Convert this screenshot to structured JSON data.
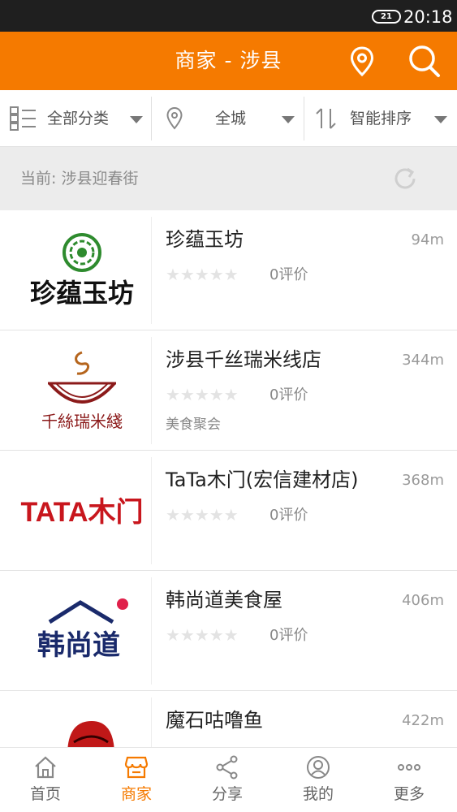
{
  "status_bar": {
    "battery": "21",
    "time": "20:18"
  },
  "header": {
    "title": "商家 - 涉县",
    "icons": [
      "location-pin-icon",
      "search-icon"
    ]
  },
  "filters": [
    {
      "label": "全部分类",
      "icon": "category-grid-icon"
    },
    {
      "label": "全城",
      "icon": "location-pin-icon"
    },
    {
      "label": "智能排序",
      "icon": "sort-arrows-icon"
    }
  ],
  "current_location": {
    "text": "当前: 涉县迎春街",
    "icon": "refresh-icon"
  },
  "merchants": [
    {
      "name": "珍蕴玉坊",
      "distance": "94m",
      "stars": 0,
      "reviews": "0评价",
      "category": "",
      "logo_text": "珍蕴玉坊"
    },
    {
      "name": "涉县千丝瑞米线店",
      "distance": "344m",
      "stars": 0,
      "reviews": "0评价",
      "category": "美食聚会",
      "logo_text": "千絲瑞米綫"
    },
    {
      "name": "TaTa木门(宏信建材店)",
      "distance": "368m",
      "stars": 0,
      "reviews": "0评价",
      "category": "",
      "logo_text": "TATA木门"
    },
    {
      "name": "韩尚道美食屋",
      "distance": "406m",
      "stars": 0,
      "reviews": "0评价",
      "category": "",
      "logo_text": "韩尚道"
    },
    {
      "name": "魔石咕噜鱼",
      "distance": "422m",
      "stars": 0,
      "reviews": "",
      "category": "",
      "logo_text": ""
    }
  ],
  "tabs": [
    {
      "label": "首页",
      "icon": "home-icon",
      "active": false
    },
    {
      "label": "商家",
      "icon": "store-icon",
      "active": true
    },
    {
      "label": "分享",
      "icon": "share-icon",
      "active": false
    },
    {
      "label": "我的",
      "icon": "user-icon",
      "active": false
    },
    {
      "label": "更多",
      "icon": "more-dots-icon",
      "active": false
    }
  ],
  "colors": {
    "accent": "#f57a00",
    "status_bar": "#1f1f1f",
    "star_empty": "#e3e3e3"
  }
}
